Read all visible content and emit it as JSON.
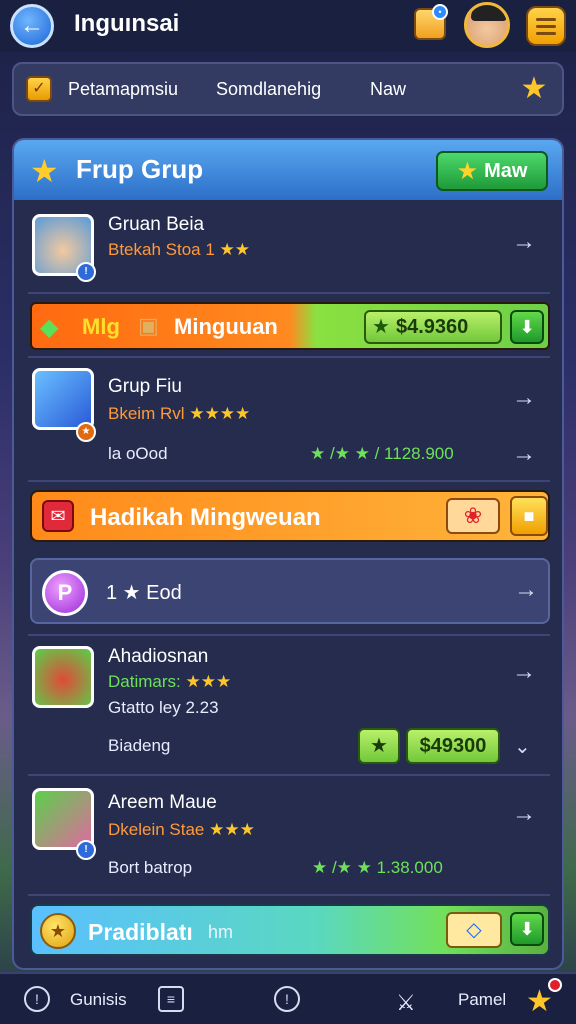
{
  "header": {
    "title": "Inguınsai"
  },
  "tabs": {
    "items": [
      "Petamapmsiu",
      "Somdlanehig",
      "Naw"
    ]
  },
  "panel": {
    "title": "Frup Grup",
    "header_button": "Maw"
  },
  "items": [
    {
      "title": "Gruan Beia",
      "subtitle": "Btekah Stoa 1",
      "stars": "★★"
    },
    {
      "title": "Grup Fiu",
      "subtitle": "Bkeim Rvl",
      "stars": "★★★★",
      "extra_left": "la oOod",
      "extra_right": "★ /★ ★ /  1128.900"
    },
    {
      "title": "Ahadiosnan",
      "subtitle": "Datimars:",
      "stars": "★★★",
      "line2": "Gtatto ley 2.23",
      "extra_left": "Biadeng",
      "price": "$49300"
    },
    {
      "title": "Areem Maue",
      "subtitle": "Dkelein Stae",
      "stars": "★★★",
      "extra_left": "Bort batrop",
      "extra_right": "★ /★ ★  1.38.000"
    }
  ],
  "banners": {
    "a_label1": "Mlg",
    "a_label2": "Minguuan",
    "a_price": "$4.9360",
    "b_label": "Hadikah Mingweuan",
    "c_label": "1 ★ Eod",
    "d_label": "Pradiblatı",
    "d_label2": "hm"
  },
  "bottom_nav": {
    "left_label": "Gunisis",
    "right_label": "Pamel"
  },
  "icons": [
    "back-arrow-icon",
    "gift-icon",
    "avatar",
    "menu-icon",
    "check-icon",
    "star-icon",
    "gem-icon",
    "box-icon",
    "coin-icon",
    "flower-icon",
    "fish-icon",
    "arrow-right-icon",
    "chevron-down-icon",
    "clock-icon",
    "list-icon",
    "sword-icon"
  ],
  "colors": {
    "accent_blue": "#2c6fc8",
    "green": "#1f9a3a",
    "orange": "#ff8a20",
    "gold": "#ffc62a"
  }
}
